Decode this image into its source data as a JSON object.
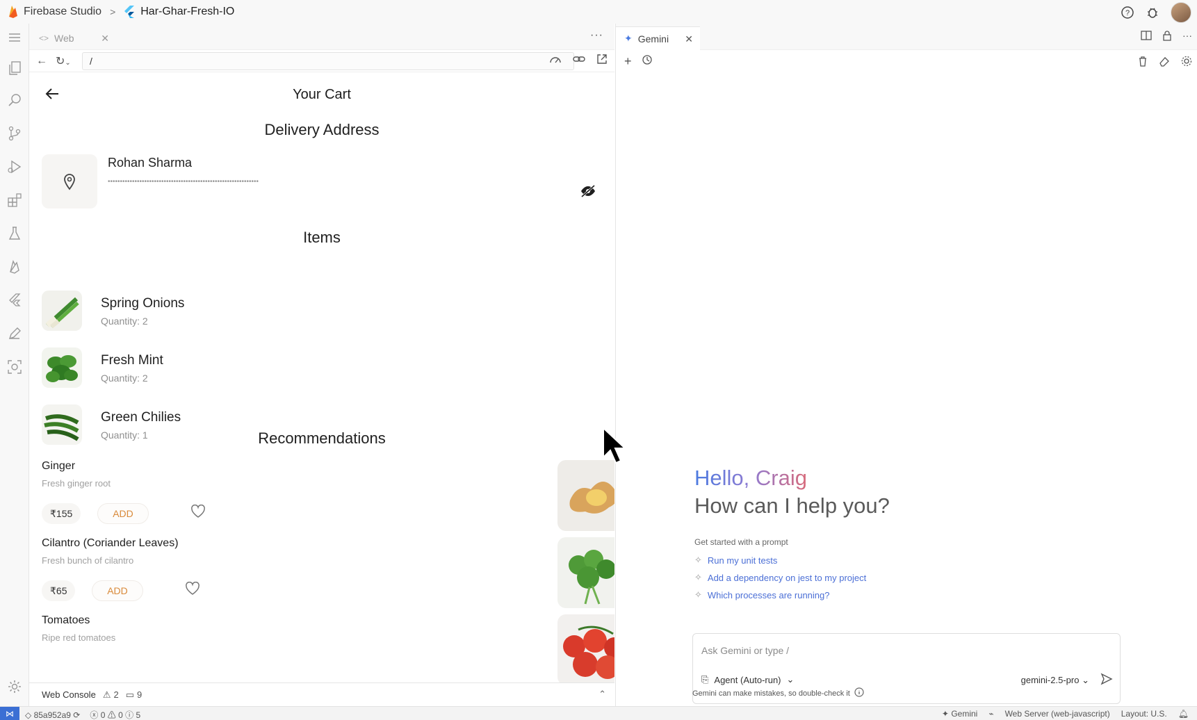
{
  "topbar": {
    "brand": "Firebase Studio",
    "separator": ">",
    "project": "Har-Ghar-Fresh-IO"
  },
  "web_panel": {
    "tab_label": "Web",
    "url": "/",
    "app": {
      "title": "Your Cart",
      "delivery_heading": "Delivery Address",
      "address_name": "Rohan Sharma",
      "address_masked": "••••••••••••••••••••••••••••••••••••••••••••••••••••••••••••••",
      "items_heading": "Items",
      "items": [
        {
          "name": "Spring Onions",
          "qty": "Quantity: 2",
          "icon": "spring-onion"
        },
        {
          "name": "Fresh Mint",
          "qty": "Quantity: 2",
          "icon": "mint"
        },
        {
          "name": "Green Chilies",
          "qty": "Quantity: 1",
          "icon": "chilies"
        }
      ],
      "recommendations_heading": "Recommendations",
      "recommendations": [
        {
          "name": "Ginger",
          "desc": "Fresh ginger root",
          "price": "₹155",
          "add": "ADD"
        },
        {
          "name": "Cilantro (Coriander Leaves)",
          "desc": "Fresh bunch of cilantro",
          "price": "₹65",
          "add": "ADD"
        },
        {
          "name": "Tomatoes",
          "desc": "Ripe red tomatoes",
          "price": "",
          "add": ""
        }
      ]
    },
    "console": {
      "label": "Web Console",
      "warnings": "2",
      "messages": "9"
    }
  },
  "gemini_panel": {
    "tab_label": "Gemini",
    "greeting": "Hello, Craig",
    "subgreeting": "How can I help you?",
    "prompt_heading": "Get started with a prompt",
    "prompts": [
      "Run my unit tests",
      "Add a dependency on jest to my project",
      "Which processes are running?"
    ],
    "input_placeholder": "Ask Gemini or type /",
    "agent_mode": "Agent (Auto-run)",
    "model": "gemini-2.5-pro",
    "disclaimer": "Gemini can make mistakes, so double-check it"
  },
  "statusbar": {
    "commit": "85a952a9",
    "errors": "0",
    "warnings": "0",
    "info": "5",
    "gemini": "Gemini",
    "server": "Web Server (web-javascript)",
    "layout": "Layout: U.S."
  },
  "colors": {
    "accent": "#3b6fd4",
    "add_button_text": "#d98a3a",
    "prompt_link": "#4b6fd6"
  }
}
